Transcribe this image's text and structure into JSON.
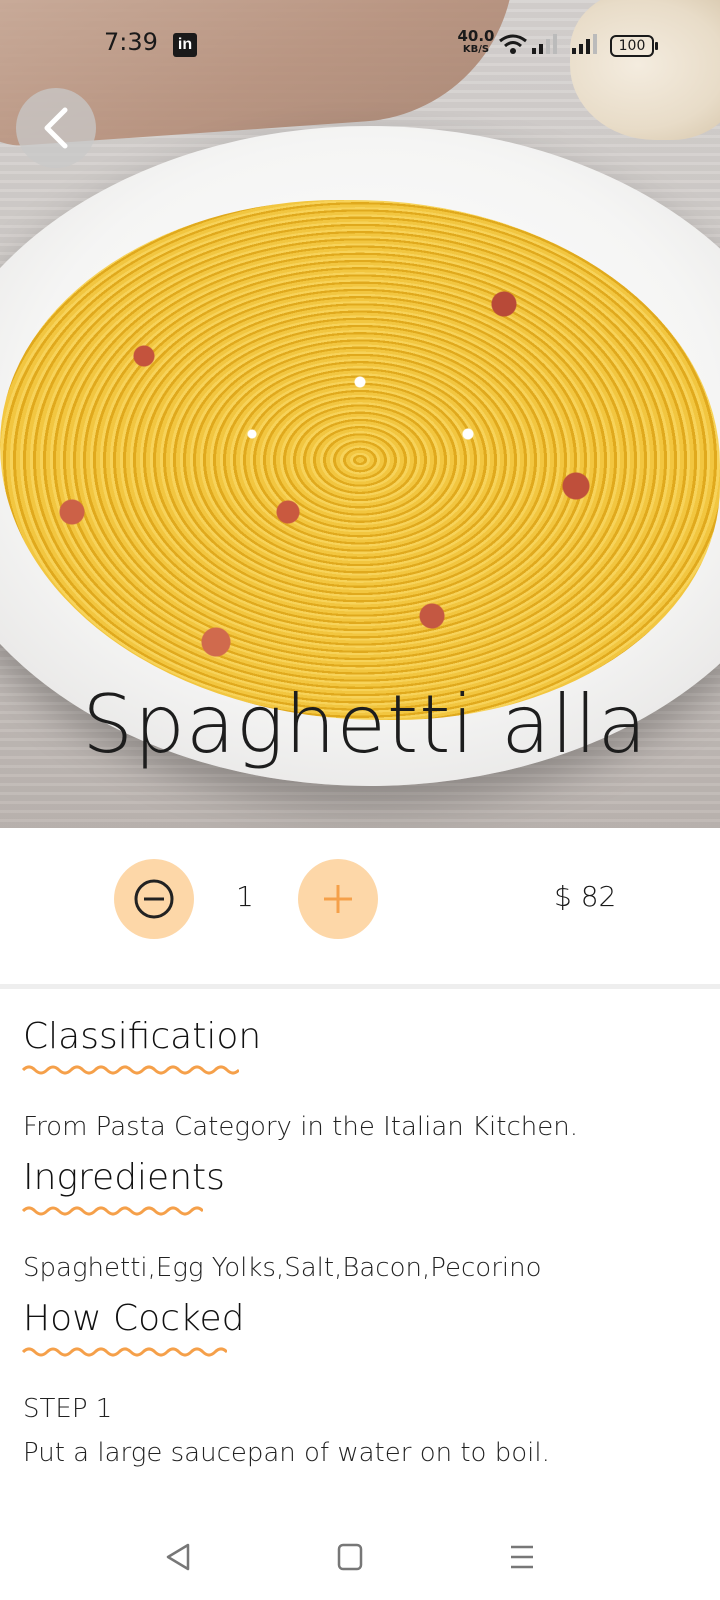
{
  "status_bar": {
    "time": "7:39",
    "linkedin_badge": "in",
    "net_speed_value": "40.0",
    "net_speed_unit": "KB/S",
    "battery": "100"
  },
  "hero": {
    "title": "Spaghetti alla"
  },
  "order": {
    "quantity": "1",
    "price": "$ 82"
  },
  "sections": {
    "classification_heading": "Classification",
    "classification_text": "From Pasta Category in the Italian Kitchen.",
    "ingredients_heading": "Ingredients",
    "ingredients_text": "Spaghetti,Egg Yolks,Salt,Bacon,Pecorino",
    "method_heading": "How Cocked",
    "step_label": "STEP 1",
    "step_text": "Put a large saucepan of water on to boil."
  },
  "colors": {
    "accent": "#fdd7a8",
    "accent_dark": "#f5a04a",
    "underline": "#f5a04a"
  },
  "icons": [
    "back-icon",
    "minus-icon",
    "plus-icon",
    "nav-back-icon",
    "nav-home-icon",
    "nav-menu-icon"
  ]
}
